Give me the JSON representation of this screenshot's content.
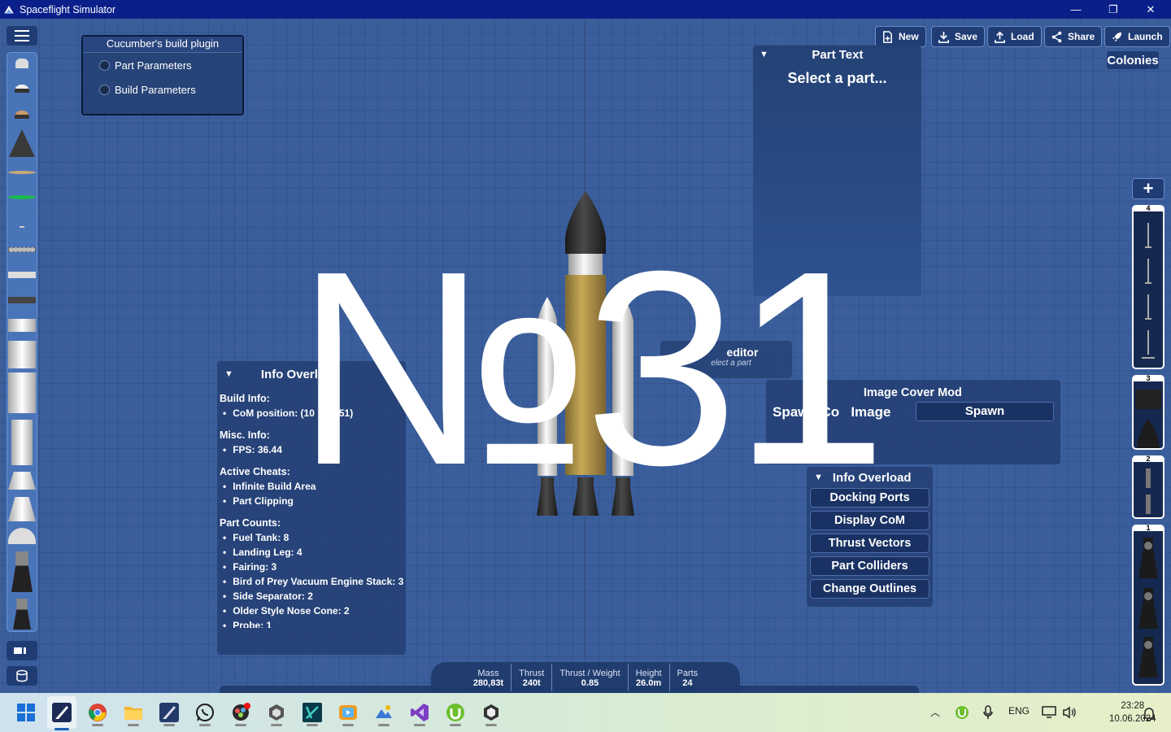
{
  "window": {
    "title": "Spaceflight Simulator",
    "minimize": "—",
    "maximize": "❐",
    "close": "✕"
  },
  "plugin": {
    "title": "Cucumber's build plugin",
    "items": [
      "Part Parameters",
      "Build Parameters"
    ]
  },
  "toolbar": {
    "new": "New",
    "save": "Save",
    "load": "Load",
    "share": "Share",
    "launch": "Launch",
    "colonies": "Colonies"
  },
  "part_text": {
    "title": "Part Text",
    "message": "Select a part..."
  },
  "info_overload": {
    "title": "Info Overload",
    "build_info_title": "Build Info:",
    "build_info": [
      "CoM position: (10    43.51)"
    ],
    "misc_title": "Misc. Info:",
    "misc": [
      "FPS: 36.44"
    ],
    "cheats_title": "Active Cheats:",
    "cheats": [
      "Infinite Build Area",
      "Part Clipping"
    ],
    "counts_title": "Part Counts:",
    "counts": [
      "Fuel Tank: 8",
      "Landing Leg: 4",
      "Fairing: 3",
      "Bird of Prey Vacuum Engine Stack: 3",
      "Side Separator: 2",
      "Older Style Nose Cone: 2",
      "Probe: 1"
    ]
  },
  "part_editor": {
    "title": "editor",
    "subtitle": "elect a part"
  },
  "image_cover": {
    "title": "Image Cover Mod",
    "label": "Spawn Co   Image",
    "button": "Spawn"
  },
  "overload_menu": {
    "title": "Info Overload",
    "buttons": [
      "Docking Ports",
      "Display CoM",
      "Thrust Vectors",
      "Part Colliders",
      "Change Outlines"
    ]
  },
  "overlay": {
    "text": "№31"
  },
  "stages": [
    {
      "label": "4"
    },
    {
      "label": "3"
    },
    {
      "label": "2"
    },
    {
      "label": "1"
    }
  ],
  "stats": [
    {
      "label": "Mass",
      "value": "280,83t"
    },
    {
      "label": "Thrust",
      "value": "240t"
    },
    {
      "label": "Thrust / Weight",
      "value": "0.85"
    },
    {
      "label": "Height",
      "value": "26.0m"
    },
    {
      "label": "Parts",
      "value": "24"
    }
  ],
  "taskbar": {
    "apps": [
      "start-icon",
      "spaceflight-simulator-icon",
      "chrome-icon",
      "file-explorer-icon",
      "spaceflight-simulator-2-icon",
      "whatsapp-icon",
      "davinci-icon",
      "unity-hub-icon",
      "blue-app-icon",
      "media-player-icon",
      "photos-icon",
      "visual-studio-icon",
      "utorrent-icon",
      "unity-icon"
    ],
    "lang": "ENG",
    "time": "23:28",
    "date": "10.06.2024"
  },
  "colors": {
    "accent": "#2f5491",
    "titlebar": "#0a1f8a",
    "panel": "#264276"
  }
}
